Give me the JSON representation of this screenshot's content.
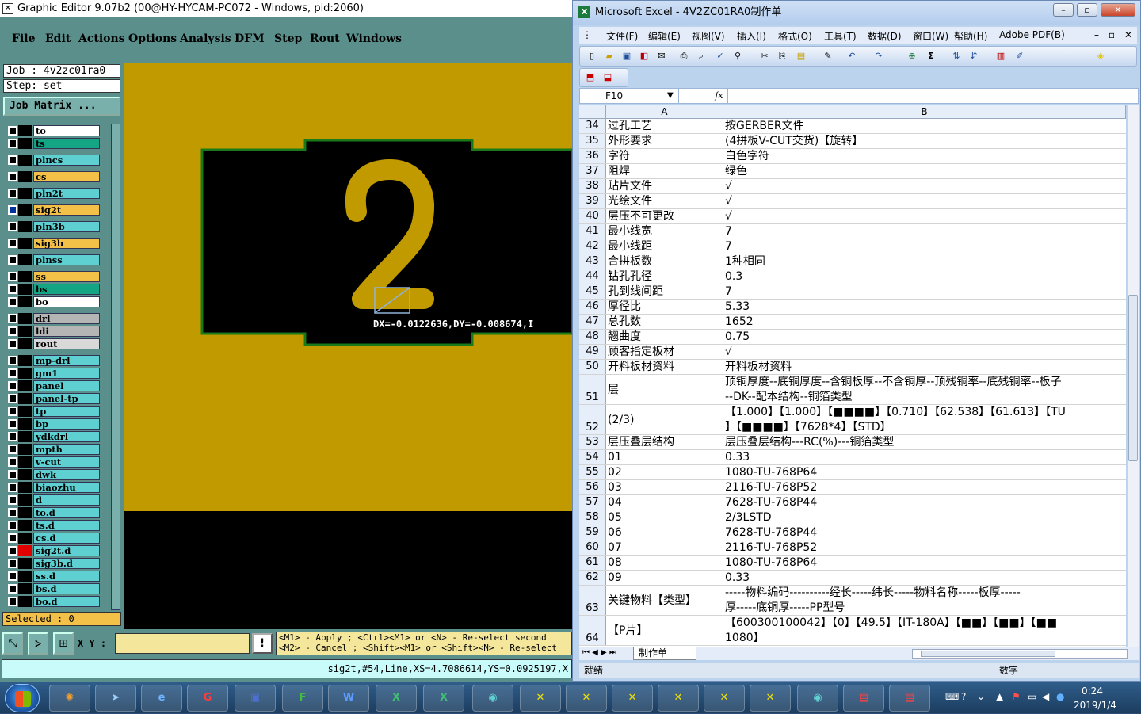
{
  "genesis": {
    "title": "Graphic Editor 9.07b2 (00@HY-HYCAM-PC072 - Windows, pid:2060)",
    "menu": [
      "File",
      "Edit",
      "Actions",
      "Options",
      "Analysis",
      "DFM",
      "Step",
      "Rout",
      "Windows"
    ],
    "job_label": "Job : 4v2zc01ra0",
    "step_label": "Step: set",
    "job_matrix_button": "Job Matrix ...",
    "layers": [
      {
        "name": "to",
        "color": "#ffffff"
      },
      {
        "name": "ts",
        "color": "#14a585"
      },
      {
        "name": "plncs",
        "color": "#5fd0d2"
      },
      {
        "name": "cs",
        "color": "#f4c148"
      },
      {
        "name": "pln2t",
        "color": "#5fd0d2"
      },
      {
        "name": "sig2t",
        "color": "#f4c148"
      },
      {
        "name": "pln3b",
        "color": "#5fd0d2"
      },
      {
        "name": "sig3b",
        "color": "#f4c148"
      },
      {
        "name": "plnss",
        "color": "#5fd0d2"
      },
      {
        "name": "ss",
        "color": "#f4c148"
      },
      {
        "name": "bs",
        "color": "#14a585"
      },
      {
        "name": "bo",
        "color": "#ffffff"
      },
      {
        "name": "drl",
        "color": "#b5b5b5"
      },
      {
        "name": "ldi",
        "color": "#b5b5b5"
      },
      {
        "name": "rout",
        "color": "#d9d9d9"
      },
      {
        "name": "mp-drl",
        "color": "#5fd0d2"
      },
      {
        "name": "gm1",
        "color": "#5fd0d2"
      },
      {
        "name": "panel",
        "color": "#5fd0d2"
      },
      {
        "name": "panel-tp",
        "color": "#5fd0d2"
      },
      {
        "name": "tp",
        "color": "#5fd0d2"
      },
      {
        "name": "bp",
        "color": "#5fd0d2"
      },
      {
        "name": "ydkdrl",
        "color": "#5fd0d2"
      },
      {
        "name": "mpth",
        "color": "#5fd0d2"
      },
      {
        "name": "v-cut",
        "color": "#5fd0d2"
      },
      {
        "name": "dwk",
        "color": "#5fd0d2"
      },
      {
        "name": "biaozhu",
        "color": "#5fd0d2"
      },
      {
        "name": "d",
        "color": "#5fd0d2"
      },
      {
        "name": "to.d",
        "color": "#5fd0d2"
      },
      {
        "name": "ts.d",
        "color": "#5fd0d2"
      },
      {
        "name": "cs.d",
        "color": "#5fd0d2"
      },
      {
        "name": "sig2t.d",
        "color": "#5fd0d2"
      },
      {
        "name": "sig3b.d",
        "color": "#5fd0d2"
      },
      {
        "name": "ss.d",
        "color": "#5fd0d2"
      },
      {
        "name": "bs.d",
        "color": "#5fd0d2"
      },
      {
        "name": "bo.d",
        "color": "#5fd0d2"
      }
    ],
    "selected": "Selected : 0",
    "canvas_text": "DX=-0.0122636,DY=-0.008674,I",
    "canvas_digit": "2",
    "xy_label": "X Y :",
    "xy_value": "",
    "hint_line1": "<M1> - Apply  ; <Ctrl><M1> or <N> - Re-select second",
    "hint_line2": "<M2> - Cancel ; <Shift><M1> or <Shift><N> - Re-select",
    "status": "sig2t,#54,Line,XS=4.7086614,YS=0.0925197,X"
  },
  "excel": {
    "title": "Microsoft Excel - 4V2ZC01RA0制作单",
    "menu": [
      "文件(F)",
      "编辑(E)",
      "视图(V)",
      "插入(I)",
      "格式(O)",
      "工具(T)",
      "数据(D)",
      "窗口(W)",
      "帮助(H)",
      "Adobe PDF(B)"
    ],
    "name_box": "F10",
    "fx_label": "fx",
    "col_a": "A",
    "col_b": "B",
    "rows": [
      {
        "n": "34",
        "a": "过孔工艺",
        "b": "按GERBER文件"
      },
      {
        "n": "35",
        "a": "外形要求",
        "b": "(4拼板V-CUT交货)【旋转】"
      },
      {
        "n": "36",
        "a": "字符",
        "b": "白色字符"
      },
      {
        "n": "37",
        "a": "阻焊",
        "b": "绿色"
      },
      {
        "n": "38",
        "a": "贴片文件",
        "b": "√"
      },
      {
        "n": "39",
        "a": "光绘文件",
        "b": "√"
      },
      {
        "n": "40",
        "a": "层压不可更改",
        "b": "√"
      },
      {
        "n": "41",
        "a": "最小线宽",
        "b": "7"
      },
      {
        "n": "42",
        "a": "最小线距",
        "b": "7"
      },
      {
        "n": "43",
        "a": "合拼板数",
        "b": "1种相同"
      },
      {
        "n": "44",
        "a": "钻孔孔径",
        "b": "0.3"
      },
      {
        "n": "45",
        "a": "孔到线间距",
        "b": "7"
      },
      {
        "n": "46",
        "a": "厚径比",
        "b": "5.33"
      },
      {
        "n": "47",
        "a": "总孔数",
        "b": "1652"
      },
      {
        "n": "48",
        "a": "翘曲度",
        "b": "0.75"
      },
      {
        "n": "49",
        "a": "顾客指定板材",
        "b": "√"
      },
      {
        "n": "50",
        "a": "开料板材资料",
        "b": "开料板材资料"
      },
      {
        "n": "51",
        "a": "层",
        "b": "顶铜厚度--底铜厚度--含铜板厚--不含铜厚--顶残铜率--底残铜率--板子",
        "b2": "--DK--配本结构--铜箔类型"
      },
      {
        "n": "52",
        "a": "(2/3)",
        "b": "【1.000】【1.000】【■■■■】【0.710】【62.538】【61.613】【TU",
        "b2": "】【■■■■】【7628*4】【STD】"
      },
      {
        "n": "53",
        "a": "层压叠层结构",
        "b": "层压叠层结构---RC(%)---铜箔类型"
      },
      {
        "n": "54",
        "a": "01",
        "b": "0.33"
      },
      {
        "n": "55",
        "a": "02",
        "b": "1080-TU-768P64"
      },
      {
        "n": "56",
        "a": "03",
        "b": "2116-TU-768P52"
      },
      {
        "n": "57",
        "a": "04",
        "b": "7628-TU-768P44"
      },
      {
        "n": "58",
        "a": "05",
        "b": "2/3LSTD"
      },
      {
        "n": "59",
        "a": "06",
        "b": "7628-TU-768P44"
      },
      {
        "n": "60",
        "a": "07",
        "b": "2116-TU-768P52"
      },
      {
        "n": "61",
        "a": "08",
        "b": "1080-TU-768P64"
      },
      {
        "n": "62",
        "a": "09",
        "b": "0.33"
      },
      {
        "n": "63",
        "a": "关键物料【类型】",
        "b": "-----物料编码----------经长-----纬长-----物料名称-----板厚-----",
        "b2": "厚-----底铜厚-----PP型号"
      },
      {
        "n": "64",
        "a": "【P片】",
        "b": "【600300100042】【0】【49.5】【IT-180A】【■■】【■■】【■■",
        "b2": "1080】"
      }
    ],
    "sheet_tab": "制作单",
    "status_ready": "就绪",
    "status_num": "数字"
  },
  "taskbar": {
    "time": "0:24",
    "date": "2019/1/4"
  }
}
